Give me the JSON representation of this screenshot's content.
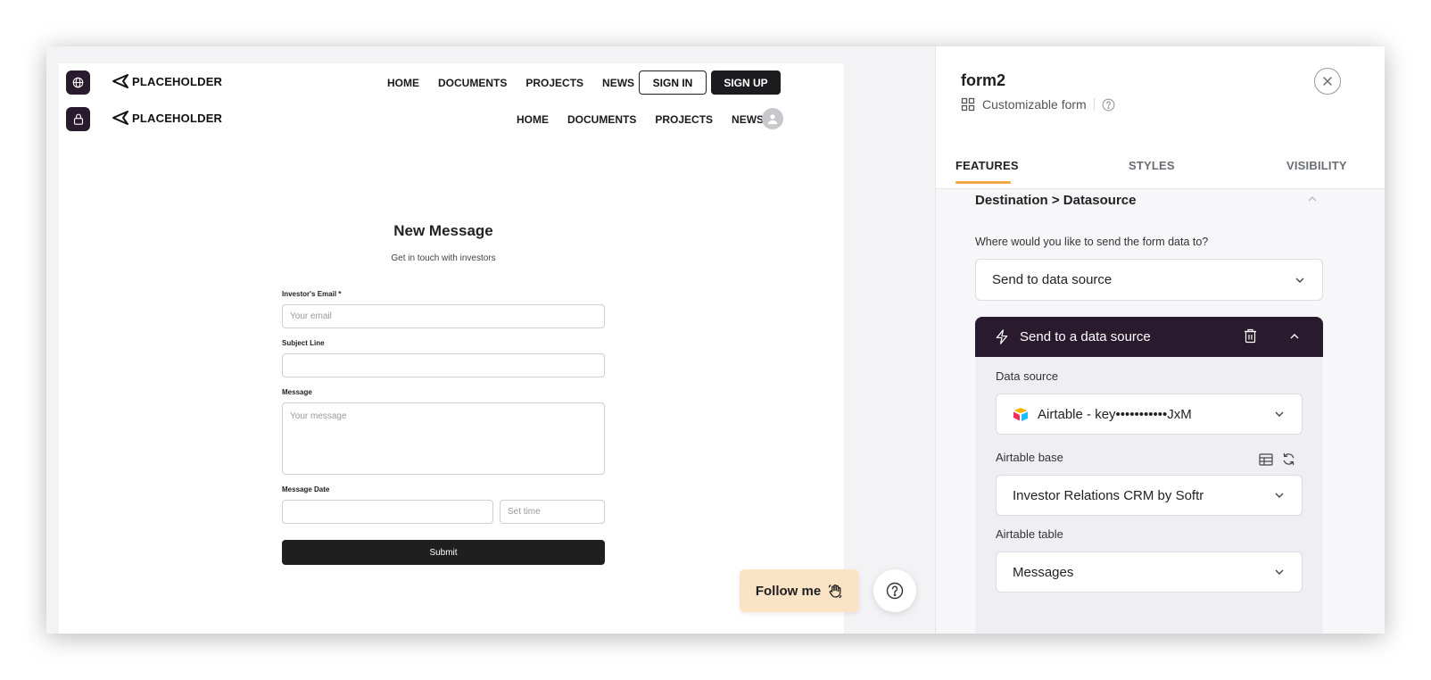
{
  "canvas": {
    "nav_top": {
      "logo_text": "PLACEHOLDER",
      "links": [
        "HOME",
        "DOCUMENTS",
        "PROJECTS",
        "NEWS"
      ],
      "signin_label": "SIGN IN",
      "signup_label": "SIGN UP"
    },
    "nav_bottom": {
      "logo_text": "PLACEHOLDER",
      "links": [
        "HOME",
        "DOCUMENTS",
        "PROJECTS",
        "NEWS"
      ]
    },
    "form": {
      "title": "New Message",
      "subtitle": "Get in touch with investors",
      "email_label": "Investor's Email *",
      "email_placeholder": "Your email",
      "subject_label": "Subject Line",
      "subject_placeholder": "",
      "message_label": "Message",
      "message_placeholder": "Your message",
      "date_label": "Message Date",
      "date_placeholder": "",
      "time_placeholder": "Set time",
      "submit_label": "Submit"
    },
    "follow_label": "Follow me"
  },
  "panel": {
    "title": "form2",
    "subtitle": "Customizable form",
    "tabs": [
      "FEATURES",
      "STYLES",
      "VISIBILITY"
    ],
    "active_tab": "FEATURES",
    "section_title": "Destination > Datasource",
    "question": "Where would you like to send the form data to?",
    "destination_value": "Send to data source",
    "card_title": "Send to a data source",
    "data_source_label": "Data source",
    "data_source_value": "Airtable - key•••••••••••JxM",
    "base_label": "Airtable base",
    "base_value": "Investor Relations CRM by Softr",
    "table_label": "Airtable table",
    "table_value": "Messages"
  },
  "colors": {
    "accent_underline": "#f0a848",
    "dark_brand": "#2a1a2e",
    "follow_bg": "#fbe3c6"
  }
}
